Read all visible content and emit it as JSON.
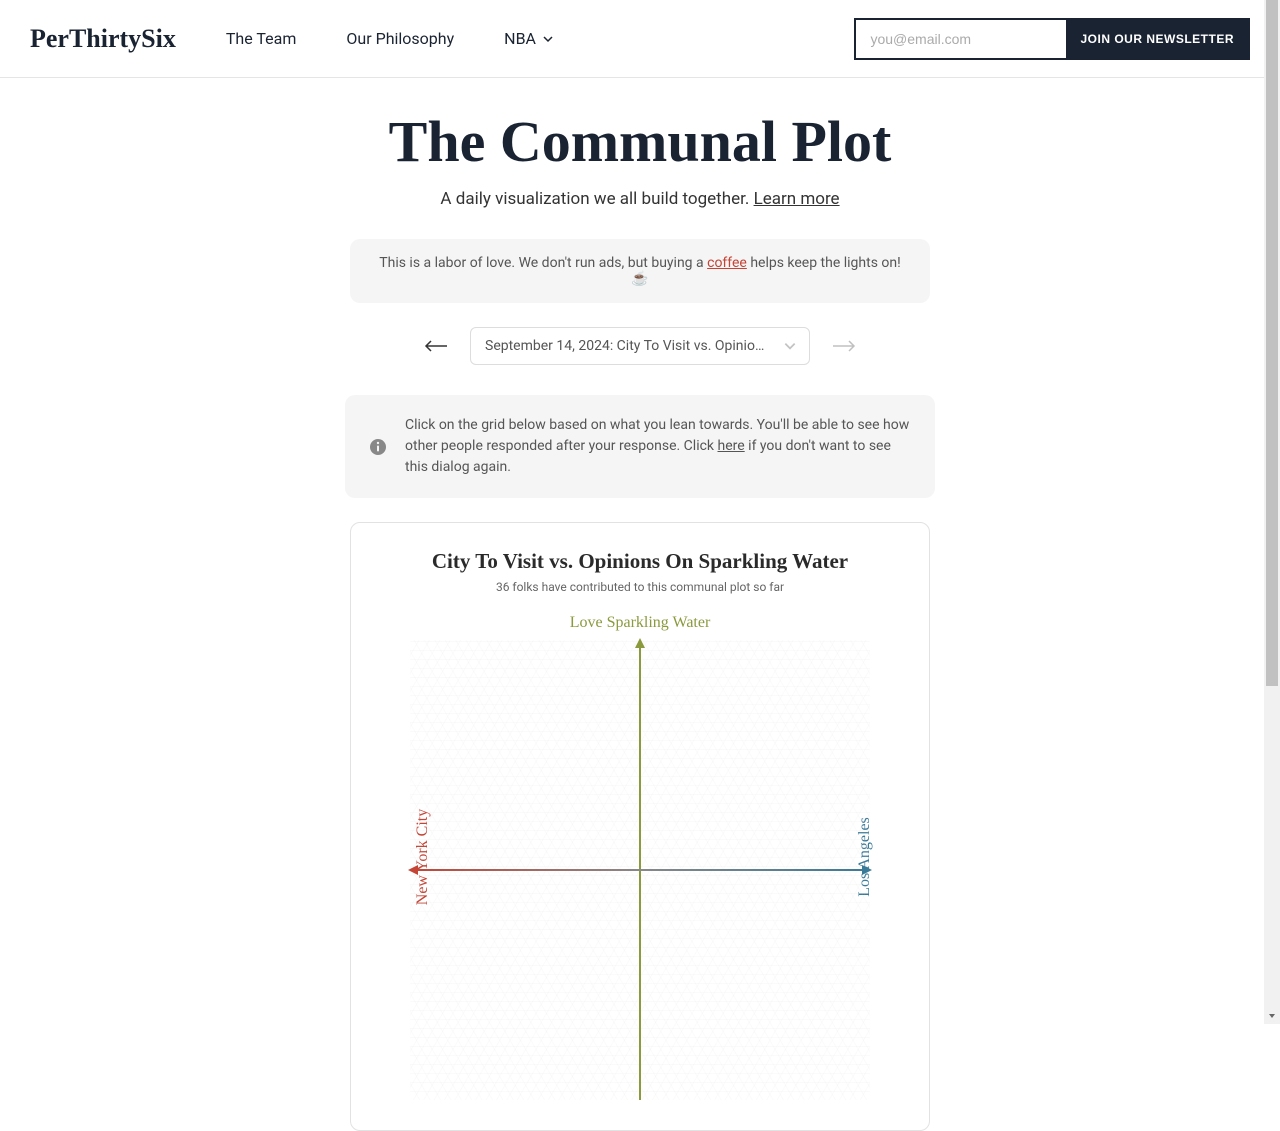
{
  "header": {
    "logo": "PerThirtySix",
    "nav": {
      "team": "The Team",
      "philosophy": "Our Philosophy",
      "nba": "NBA"
    },
    "newsletter": {
      "placeholder": "you@email.com",
      "button": "JOIN OUR NEWSLETTER"
    }
  },
  "main": {
    "title": "The Communal Plot",
    "subtitle_prefix": "A daily visualization we all build together. ",
    "subtitle_link": "Learn more",
    "support": {
      "prefix": "This is a labor of love. We don't run ads, but buying a ",
      "link": "coffee",
      "suffix": " helps keep the lights on! ☕"
    },
    "date_selector": "September 14, 2024: City To Visit vs. Opinions ...",
    "info": {
      "text_prefix": "Click on the grid below based on what you lean towards. You'll be able to see how other people responded after your response. Click ",
      "link": "here",
      "text_suffix": " if you don't want to see this dialog again."
    }
  },
  "chart_data": {
    "type": "scatter",
    "title": "City To Visit vs. Opinions On Sparkling Water",
    "subtitle": "36 folks have contributed to this communal plot so far",
    "contributor_count": 36,
    "x_axis": {
      "left_label": "New York City",
      "right_label": "Los Angeles",
      "range": [
        -1,
        1
      ]
    },
    "y_axis": {
      "top_label": "Love Sparkling Water",
      "range": [
        -1,
        1
      ]
    },
    "series": []
  }
}
